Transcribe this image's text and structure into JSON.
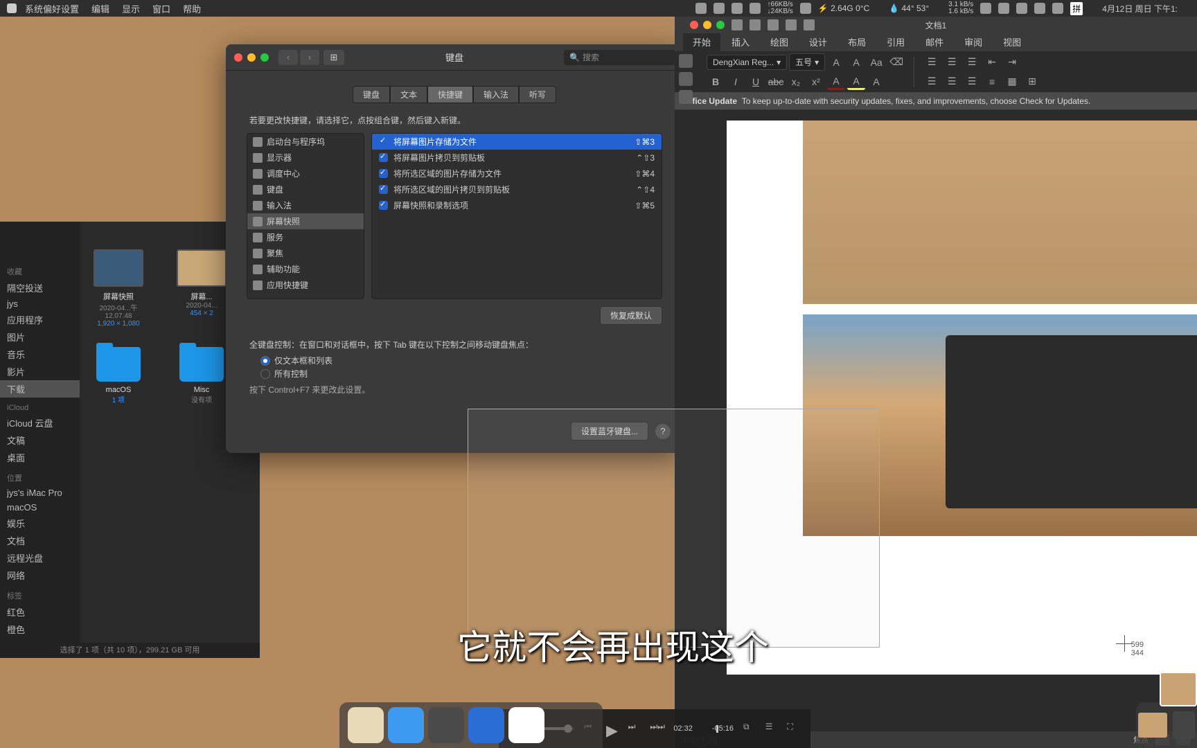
{
  "menubar": {
    "app": "系统偏好设置",
    "items": [
      "编辑",
      "显示",
      "窗口",
      "帮助"
    ],
    "right": {
      "net": {
        "up": "↑66KB/s",
        "down": "↓24KB/s"
      },
      "cpu": "⚡ 2.64G 0°C",
      "temp": "💧 44° 53°",
      "disk": {
        "up": "3.1 kB/s",
        "down": "1.6 kB/s"
      },
      "input": "拼",
      "datetime": "4月12日 周日 下午1:"
    }
  },
  "finder": {
    "sidebar": {
      "fav": "收藏",
      "items1": [
        "隔空投送",
        "jys",
        "应用程序",
        "图片",
        "音乐",
        "影片"
      ],
      "sel": "下载",
      "cloud_hdr": "iCloud",
      "cloud": [
        "iCloud 云盘",
        "文稿",
        "桌面"
      ],
      "loc_hdr": "位置",
      "loc": [
        "jys's iMac Pro",
        "macOS",
        "娱乐",
        "文档",
        "远程光盘",
        "网络"
      ],
      "tags_hdr": "标签",
      "tags": [
        "红色",
        "橙色"
      ]
    },
    "items": [
      {
        "name": "屏幕快照",
        "sub": "2020-04...午12.07.48",
        "dim": "1,920 × 1,080",
        "thumb": true
      },
      {
        "name": "屏幕...",
        "sub": "2020-04...",
        "dim": "454 × 2",
        "thumb": true
      },
      {
        "name": "macOS",
        "sub": "1 项",
        "folder": true
      },
      {
        "name": "Misc",
        "sub": "没有项",
        "folder": true
      }
    ],
    "status": "选择了 1 项（共 10 项），299.21 GB 可用"
  },
  "prefs": {
    "title": "键盘",
    "search_ph": "搜索",
    "tabs": [
      "键盘",
      "文本",
      "快捷键",
      "输入法",
      "听写"
    ],
    "active_tab": 2,
    "instruction": "若要更改快捷键，请选择它，点按组合键，然后键入新键。",
    "categories": [
      {
        "icon": "launchpad",
        "label": "启动台与程序坞"
      },
      {
        "icon": "display",
        "label": "显示器"
      },
      {
        "icon": "mission",
        "label": "调度中心"
      },
      {
        "icon": "keyboard",
        "label": "键盘"
      },
      {
        "icon": "input",
        "label": "输入法"
      },
      {
        "icon": "screenshot",
        "label": "屏幕快照",
        "sel": true
      },
      {
        "icon": "services",
        "label": "服务"
      },
      {
        "icon": "spotlight",
        "label": "聚焦"
      },
      {
        "icon": "a11y",
        "label": "辅助功能"
      },
      {
        "icon": "appshort",
        "label": "应用快捷键"
      }
    ],
    "shortcuts": [
      {
        "on": true,
        "label": "将屏幕图片存储为文件",
        "keys": "⇧⌘3",
        "sel": true
      },
      {
        "on": true,
        "label": "将屏幕图片拷贝到剪贴板",
        "keys": "⌃⇧3"
      },
      {
        "on": true,
        "label": "将所选区域的图片存储为文件",
        "keys": "⇧⌘4"
      },
      {
        "on": true,
        "label": "将所选区域的图片拷贝到剪贴板",
        "keys": "⌃⇧4"
      },
      {
        "on": true,
        "label": "屏幕快照和录制选项",
        "keys": "⇧⌘5"
      }
    ],
    "restore": "恢复成默认",
    "fka_label": "全键盘控制：在窗口和对话框中，按下 Tab 键在以下控制之间移动键盘焦点：",
    "radio": [
      {
        "label": "仅文本框和列表",
        "on": true
      },
      {
        "label": "所有控制",
        "on": false
      }
    ],
    "hint": "按下 Control+F7 来更改此设置。",
    "bt_button": "设置蓝牙键盘..."
  },
  "word": {
    "doctitle": "文档1",
    "tabs": [
      "开始",
      "插入",
      "绘图",
      "设计",
      "布局",
      "引用",
      "邮件",
      "审阅",
      "视图"
    ],
    "active_tab": 0,
    "font": "DengXian Reg...",
    "fontsize": "五号",
    "update": {
      "title": "Office Update",
      "msg": "To keep up-to-date with security updates, fixes, and improvements, choose Check for Updates."
    },
    "status": {
      "lang": "中文(中国)",
      "focus": "焦点"
    },
    "crosshair": {
      "x": "599",
      "y": "344"
    }
  },
  "media": {
    "cur": "02:32",
    "rem": "-05:16"
  },
  "subtitle": "它就不会再出现这个"
}
